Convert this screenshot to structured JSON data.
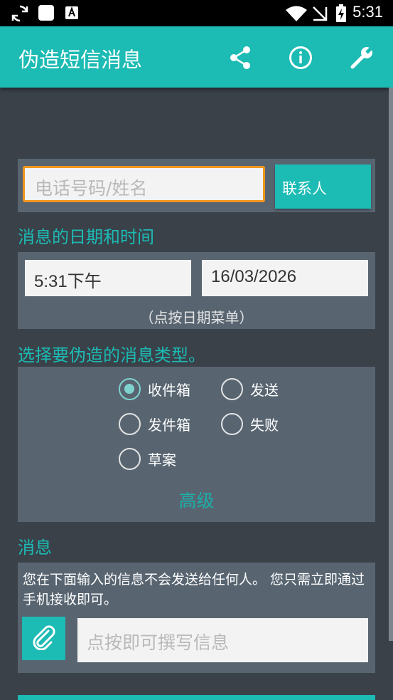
{
  "status_bar": {
    "time": "5:31",
    "icons": [
      "sync-icon",
      "square-icon",
      "font-a-icon",
      "wifi-icon",
      "signal-off-icon",
      "battery-charging-icon"
    ]
  },
  "app_bar": {
    "title": "伪造短信消息",
    "actions": [
      "share-icon",
      "info-icon",
      "wrench-icon"
    ]
  },
  "recipient": {
    "placeholder": "电话号码/姓名",
    "contacts_button": "联系人"
  },
  "datetime": {
    "label": "消息的日期和时间",
    "time_value": "5:31下午",
    "date_value": "16/03/2026",
    "hint": "（点按日期菜单）"
  },
  "type": {
    "label": "选择要伪造的消息类型。",
    "options": [
      {
        "label": "收件箱",
        "checked": true
      },
      {
        "label": "发送",
        "checked": false
      },
      {
        "label": "发件箱",
        "checked": false
      },
      {
        "label": "失败",
        "checked": false
      },
      {
        "label": "草案",
        "checked": false
      }
    ],
    "advanced": "高级"
  },
  "message": {
    "label": "消息",
    "notice": "您在下面输入的信息不会发送给任何人。 您只需立即通过手机接收即可。",
    "placeholder": "点按即可撰写信息"
  },
  "colors": {
    "accent": "#1cbbb4",
    "background": "#3a4149",
    "panel": "#586571",
    "focus_border": "#f0951f"
  }
}
